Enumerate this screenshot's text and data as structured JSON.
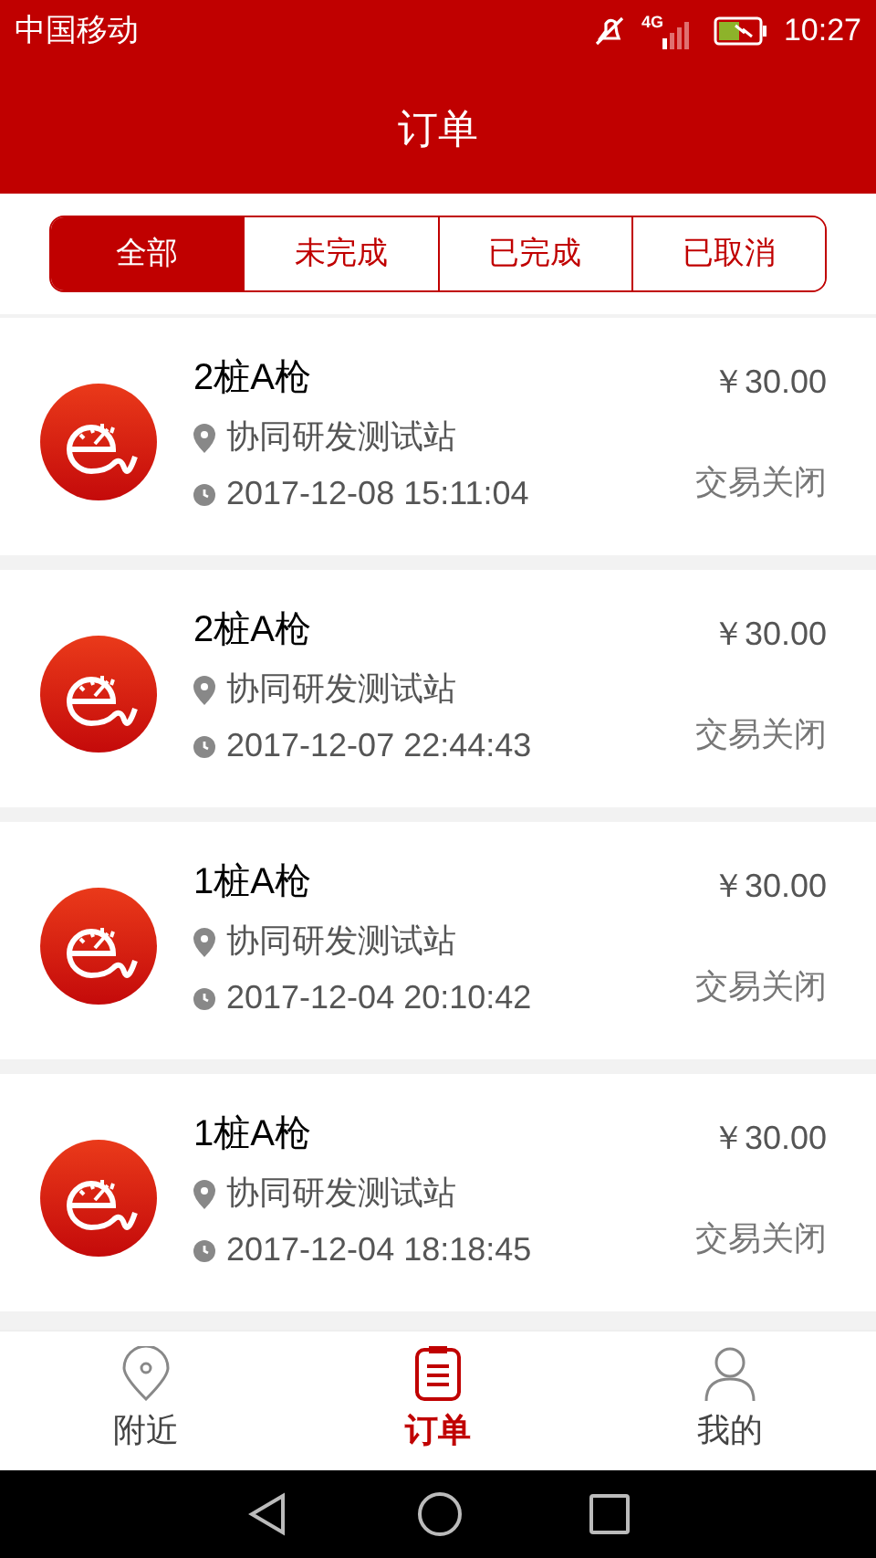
{
  "status_bar": {
    "carrier": "中国移动",
    "network": "4G",
    "time": "10:27"
  },
  "header": {
    "title": "订单"
  },
  "tabs": [
    {
      "label": "全部",
      "selected": true
    },
    {
      "label": "未完成",
      "selected": false
    },
    {
      "label": "已完成",
      "selected": false
    },
    {
      "label": "已取消",
      "selected": false
    }
  ],
  "orders": [
    {
      "title": "2桩A枪",
      "station": "协同研发测试站",
      "time": "2017-12-08 15:11:04",
      "price": "￥30.00",
      "status": "交易关闭"
    },
    {
      "title": "2桩A枪",
      "station": "协同研发测试站",
      "time": "2017-12-07 22:44:43",
      "price": "￥30.00",
      "status": "交易关闭"
    },
    {
      "title": "1桩A枪",
      "station": "协同研发测试站",
      "time": "2017-12-04 20:10:42",
      "price": "￥30.00",
      "status": "交易关闭"
    },
    {
      "title": "1桩A枪",
      "station": "协同研发测试站",
      "time": "2017-12-04 18:18:45",
      "price": "￥30.00",
      "status": "交易关闭"
    }
  ],
  "bottom_nav": [
    {
      "kind": "nearby",
      "label": "附近",
      "selected": false
    },
    {
      "kind": "orders",
      "label": "订单",
      "selected": true
    },
    {
      "kind": "profile",
      "label": "我的",
      "selected": false
    }
  ]
}
